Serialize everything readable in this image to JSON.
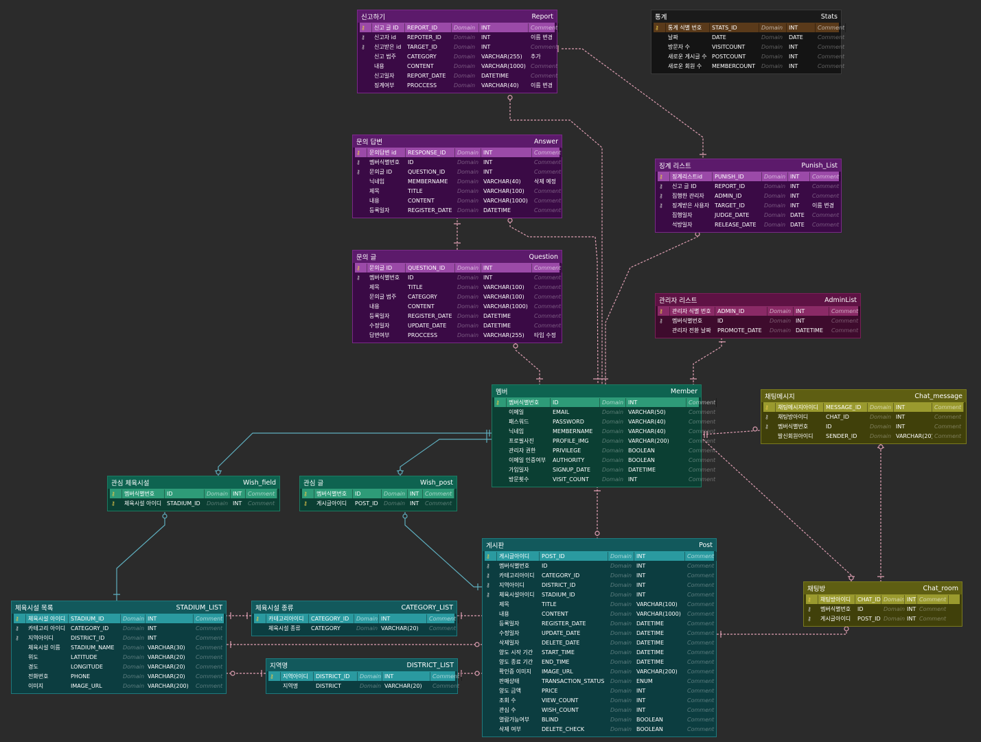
{
  "tables": [
    {
      "id": "report",
      "name": "신고하기",
      "code": "Report",
      "theme": "purple",
      "pos": [
        520,
        14,
        292
      ],
      "cols": [
        18,
        48,
        68,
        40,
        72,
        44
      ],
      "rows": [
        [
          "pk",
          "신고 글 ID",
          "REPORT_ID",
          "Domain",
          "INT",
          "Comment"
        ],
        [
          "fk",
          "신고자 id",
          "REPOTER_ID",
          "Domain",
          "INT",
          "이름 변경"
        ],
        [
          "fk",
          "신고받은 id",
          "TARGET_ID",
          "Domain",
          "INT",
          "Comment"
        ],
        [
          "",
          "신고 범주",
          "CATEGORY",
          "Domain",
          "VARCHAR(255)",
          "추가"
        ],
        [
          "",
          "내용",
          "CONTENT",
          "Domain",
          "VARCHAR(1000)",
          "Comment"
        ],
        [
          "",
          "신고일자",
          "REPORT_DATE",
          "Domain",
          "DATETIME",
          "Comment"
        ],
        [
          "",
          "징계여부",
          "PROCCESS",
          "Domain",
          "VARCHAR(40)",
          "이름 변경"
        ]
      ]
    },
    {
      "id": "stats",
      "name": "통계",
      "code": "Stats",
      "theme": "black",
      "pos": [
        948,
        14,
        278
      ],
      "cols": [
        18,
        64,
        72,
        40,
        42,
        44
      ],
      "rows": [
        [
          "pk",
          "통계 식별 번호",
          "STATS_ID",
          "Domain",
          "INT",
          "Comment"
        ],
        [
          "",
          "날짜",
          "DATE",
          "Domain",
          "DATE",
          "Comment"
        ],
        [
          "",
          "방문자 수",
          "VISITCOUNT",
          "Domain",
          "INT",
          "Comment"
        ],
        [
          "",
          "새로운 게시글 수",
          "POSTCOUNT",
          "Domain",
          "INT",
          "Comment"
        ],
        [
          "",
          "새로운 회원 수",
          "MEMBERCOUNT",
          "Domain",
          "INT",
          "Comment"
        ]
      ]
    },
    {
      "id": "answer",
      "name": "문의 답변",
      "code": "Answer",
      "theme": "purple",
      "pos": [
        513,
        196,
        306
      ],
      "cols": [
        18,
        56,
        72,
        38,
        74,
        44
      ],
      "rows": [
        [
          "pk",
          "문의답변 id",
          "RESPONSE_ID",
          "Domain",
          "INT",
          "Comment"
        ],
        [
          "fk",
          "멤버식별번호",
          "ID",
          "Domain",
          "INT",
          "Comment"
        ],
        [
          "fk",
          "문의글 ID",
          "QUESTION_ID",
          "Domain",
          "INT",
          "Comment"
        ],
        [
          "",
          "닉네임",
          "MEMBERNAME",
          "Domain",
          "VARCHAR(40)",
          "삭제 예정"
        ],
        [
          "",
          "제목",
          "TITLE",
          "Domain",
          "VARCHAR(100)",
          "Comment"
        ],
        [
          "",
          "내용",
          "CONTENT",
          "Domain",
          "VARCHAR(1000)",
          "Comment"
        ],
        [
          "",
          "등록일자",
          "REGISTER_DATE",
          "Domain",
          "DATETIME",
          "Comment"
        ]
      ]
    },
    {
      "id": "punish",
      "name": "징계 리스트",
      "code": "Punish_List",
      "theme": "purple",
      "pos": [
        954,
        231,
        272
      ],
      "cols": [
        18,
        62,
        72,
        38,
        32,
        44
      ],
      "rows": [
        [
          "pk",
          "징계리스트id",
          "PUNISH_ID",
          "Domain",
          "INT",
          "Comment"
        ],
        [
          "fk",
          "신고 글 ID",
          "REPORT_ID",
          "Domain",
          "INT",
          "Comment"
        ],
        [
          "fk",
          "집행한 관리자",
          "ADMIN_ID",
          "Domain",
          "INT",
          "Comment"
        ],
        [
          "fk",
          "징계받은 사용자",
          "TARGET_ID",
          "Domain",
          "INT",
          "이름 변경"
        ],
        [
          "",
          "집행일자",
          "JUDGE_DATE",
          "Domain",
          "DATE",
          "Comment"
        ],
        [
          "",
          "석방일자",
          "RELEASE_DATE",
          "Domain",
          "DATE",
          "Comment"
        ]
      ]
    },
    {
      "id": "question",
      "name": "문의 글",
      "code": "Question",
      "theme": "purple",
      "pos": [
        513,
        364,
        306
      ],
      "cols": [
        18,
        56,
        72,
        38,
        74,
        44
      ],
      "rows": [
        [
          "pk",
          "문의글 ID",
          "QUESTION_ID",
          "Domain",
          "INT",
          "Comment"
        ],
        [
          "fk",
          "멤버식별번호",
          "ID",
          "Domain",
          "INT",
          "Comment"
        ],
        [
          "",
          "제목",
          "TITLE",
          "Domain",
          "VARCHAR(100)",
          "Comment"
        ],
        [
          "",
          "문의글 범주",
          "CATEGORY",
          "Domain",
          "VARCHAR(100)",
          "Comment"
        ],
        [
          "",
          "내용",
          "CONTENT",
          "Domain",
          "VARCHAR(1000)",
          "Comment"
        ],
        [
          "",
          "등록일자",
          "REGISTER_DATE",
          "Domain",
          "DATETIME",
          "Comment"
        ],
        [
          "",
          "수정일자",
          "UPDATE_DATE",
          "Domain",
          "DATETIME",
          "Comment"
        ],
        [
          "",
          "답변여부",
          "PROCCESS",
          "Domain",
          "VARCHAR(255)",
          "타입 수정"
        ]
      ]
    },
    {
      "id": "admin",
      "name": "관리자 리스트",
      "code": "AdminList",
      "theme": "magenta",
      "pos": [
        954,
        427,
        300
      ],
      "cols": [
        18,
        66,
        76,
        38,
        52,
        44
      ],
      "rows": [
        [
          "pk",
          "관리자 식별 번호",
          "ADMIN_ID",
          "Domain",
          "INT",
          "Comment"
        ],
        [
          "fk",
          "멤버식별번호",
          "ID",
          "Domain",
          "INT",
          "Comment"
        ],
        [
          "",
          "관리자 전환 날짜",
          "PROMOTE_DATE",
          "Domain",
          "DATETIME",
          "Comment"
        ]
      ]
    },
    {
      "id": "member",
      "name": "멤버",
      "code": "Member",
      "theme": "green",
      "pos": [
        716,
        560,
        306
      ],
      "cols": [
        18,
        64,
        72,
        38,
        88,
        44
      ],
      "rows": [
        [
          "pk",
          "멤버식별번호",
          "ID",
          "Domain",
          "INT",
          "Comment"
        ],
        [
          "",
          "이메일",
          "EMAIL",
          "Domain",
          "VARCHAR(50)",
          "Comment"
        ],
        [
          "",
          "패스워드",
          "PASSWORD",
          "Domain",
          "VARCHAR(40)",
          "Comment"
        ],
        [
          "",
          "닉네임",
          "MEMBERNAME",
          "Domain",
          "VARCHAR(40)",
          "Comment"
        ],
        [
          "",
          "프로필사진",
          "PROFILE_IMG",
          "Domain",
          "VARCHAR(200)",
          "Comment"
        ],
        [
          "",
          "관리자 권한",
          "PRIVILEGE",
          "Domain",
          "BOOLEAN",
          "Comment"
        ],
        [
          "",
          "이메일 인증여부",
          "AUTHORITY",
          "Domain",
          "BOOLEAN",
          "Comment"
        ],
        [
          "",
          "가입일자",
          "SIGNUP_DATE",
          "Domain",
          "DATETIME",
          "Comment"
        ],
        [
          "",
          "방문횟수",
          "VISIT_COUNT",
          "Domain",
          "INT",
          "Comment"
        ]
      ]
    },
    {
      "id": "chatmsg",
      "name": "채팅메시지",
      "code": "Chat_message",
      "theme": "olive",
      "pos": [
        1108,
        567,
        300
      ],
      "cols": [
        18,
        70,
        64,
        38,
        56,
        46
      ],
      "rows": [
        [
          "pk",
          "채팅메시지아이디",
          "MESSAGE_ID",
          "Domain",
          "INT",
          "Comment"
        ],
        [
          "fk",
          "채팅방아이디",
          "CHAT_ID",
          "Domain",
          "INT",
          "Comment"
        ],
        [
          "fk",
          "멤버식별번호",
          "ID",
          "Domain",
          "INT",
          "Comment"
        ],
        [
          "",
          "발신회원아이디",
          "SENDER_ID",
          "Domain",
          "VARCHAR(20)",
          "Comment"
        ]
      ]
    },
    {
      "id": "wishfield",
      "name": "관심 체육시설",
      "code": "Wish_field",
      "theme": "green",
      "pos": [
        156,
        693,
        252
      ],
      "cols": [
        18,
        62,
        58,
        38,
        22,
        46
      ],
      "rows": [
        [
          "pk",
          "멤버식별번호",
          "ID",
          "Domain",
          "INT",
          "Comment"
        ],
        [
          "pk",
          "체육시설 아이디",
          "STADIUM_ID",
          "Domain",
          "INT",
          "Comment"
        ]
      ]
    },
    {
      "id": "wishpost",
      "name": "관심 글",
      "code": "Wish_post",
      "theme": "green",
      "pos": [
        436,
        693,
        230
      ],
      "cols": [
        18,
        56,
        42,
        38,
        22,
        46
      ],
      "rows": [
        [
          "pk",
          "멤버식별번호",
          "ID",
          "Domain",
          "INT",
          "Comment"
        ],
        [
          "pk",
          "게시글아이디",
          "POST_ID",
          "Domain",
          "INT",
          "Comment"
        ]
      ]
    },
    {
      "id": "post",
      "name": "게시판",
      "code": "Post",
      "theme": "teal",
      "pos": [
        702,
        784,
        342
      ],
      "cols": [
        18,
        62,
        100,
        38,
        74,
        46
      ],
      "rows": [
        [
          "pk",
          "게시글아이디",
          "POST_ID",
          "Domain",
          "INT",
          "Comment"
        ],
        [
          "fk",
          "멤버식별번호",
          "ID",
          "Domain",
          "INT",
          "Comment"
        ],
        [
          "fk",
          "카테고리아이디",
          "CATEGORY_ID",
          "Domain",
          "INT",
          "Comment"
        ],
        [
          "fk",
          "지역아이디",
          "DISTRICT_ID",
          "Domain",
          "INT",
          "Comment"
        ],
        [
          "fk",
          "체육시설아이디",
          "STADIUM_ID",
          "Domain",
          "INT",
          "Comment"
        ],
        [
          "",
          "제목",
          "TITLE",
          "Domain",
          "VARCHAR(100)",
          "Comment"
        ],
        [
          "",
          "내용",
          "CONTENT",
          "Domain",
          "VARCHAR(1000)",
          "Comment"
        ],
        [
          "",
          "등록일자",
          "REGISTER_DATE",
          "Domain",
          "DATETIME",
          "Comment"
        ],
        [
          "",
          "수정일자",
          "UPDATE_DATE",
          "Domain",
          "DATETIME",
          "Comment"
        ],
        [
          "",
          "삭제일자",
          "DELETE_DATE",
          "Domain",
          "DATETIME",
          "Comment"
        ],
        [
          "",
          "양도 시작 기간",
          "START_TIME",
          "Domain",
          "DATETIME",
          "Comment"
        ],
        [
          "",
          "양도 종료 기간",
          "END_TIME",
          "Domain",
          "DATETIME",
          "Comment"
        ],
        [
          "",
          "확인증 이미지",
          "IMAGE_URL",
          "Domain",
          "VARCHAR(200)",
          "Comment"
        ],
        [
          "",
          "판매상태",
          "TRANSACTION_STATUS",
          "Domain",
          "ENUM",
          "Comment"
        ],
        [
          "",
          "양도 금액",
          "PRICE",
          "Domain",
          "INT",
          "Comment"
        ],
        [
          "",
          "조회 수",
          "VIEW_COUNT",
          "Domain",
          "INT",
          "Comment"
        ],
        [
          "",
          "관심 수",
          "WISH_COUNT",
          "Domain",
          "INT",
          "Comment"
        ],
        [
          "",
          "열람가능여부",
          "BLIND",
          "Domain",
          "BOOLEAN",
          "Comment"
        ],
        [
          "",
          "삭제 여부",
          "DELETE_CHECK",
          "Domain",
          "BOOLEAN",
          "Comment"
        ]
      ]
    },
    {
      "id": "chatroom",
      "name": "채팅방",
      "code": "Chat_room",
      "theme": "olive",
      "pos": [
        1170,
        847,
        232
      ],
      "cols": [
        18,
        54,
        38,
        34,
        18,
        46
      ],
      "rows": [
        [
          "pk",
          "채팅방아이디",
          "CHAT_ID",
          "Domain",
          "INT",
          "Comment"
        ],
        [
          "fk",
          "멤버식별번호",
          "ID",
          "Domain",
          "INT",
          "Comment"
        ],
        [
          "fk",
          "게시글아이디",
          "POST_ID",
          "Domain",
          "INT",
          "Comment"
        ]
      ]
    },
    {
      "id": "stadium",
      "name": "체육시설 목록",
      "code": "STADIUM_LIST",
      "theme": "teal",
      "pos": [
        16,
        875,
        314
      ],
      "cols": [
        18,
        62,
        76,
        36,
        70,
        46
      ],
      "rows": [
        [
          "pk",
          "체육시설 아이디",
          "STADIUM_ID",
          "Domain",
          "INT",
          "Comment"
        ],
        [
          "fk",
          "카테고리 아이디",
          "CATEGORY_ID",
          "Domain",
          "INT",
          "Comment"
        ],
        [
          "fk",
          "지역아이디",
          "DISTRICT_ID",
          "Domain",
          "INT",
          "Comment"
        ],
        [
          "",
          "체육시설 이름",
          "STADIUM_NAME",
          "Domain",
          "VARCHAR(30)",
          "Comment"
        ],
        [
          "",
          "위도",
          "LATITUDE",
          "Domain",
          "VARCHAR(20)",
          "Comment"
        ],
        [
          "",
          "경도",
          "LONGITUDE",
          "Domain",
          "VARCHAR(20)",
          "Comment"
        ],
        [
          "",
          "전화번호",
          "PHONE",
          "Domain",
          "VARCHAR(20)",
          "Comment"
        ],
        [
          "",
          "이미지",
          "IMAGE_URL",
          "Domain",
          "VARCHAR(200)",
          "Comment"
        ]
      ]
    },
    {
      "id": "category",
      "name": "체육시설 종류",
      "code": "CATEGORY_LIST",
      "theme": "teal",
      "pos": [
        366,
        875,
        300
      ],
      "cols": [
        18,
        62,
        66,
        36,
        70,
        46
      ],
      "rows": [
        [
          "pk",
          "카테고리아이디",
          "CATEGORY_ID",
          "Domain",
          "INT",
          "Comment"
        ],
        [
          "",
          "체육시설 종류",
          "CATEGORY",
          "Domain",
          "VARCHAR(20)",
          "Comment"
        ]
      ]
    },
    {
      "id": "district",
      "name": "지역명",
      "code": "DISTRICT_LIST",
      "theme": "teal",
      "pos": [
        387,
        959,
        280
      ],
      "cols": [
        18,
        48,
        64,
        36,
        70,
        46
      ],
      "rows": [
        [
          "pk",
          "지역아이디",
          "DISTRICT_ID",
          "Domain",
          "INT",
          "Comment"
        ],
        [
          "",
          "지역명",
          "DISTRICT",
          "Domain",
          "VARCHAR(20)",
          "Comment"
        ]
      ]
    }
  ],
  "icons": {
    "pk": "key-icon",
    "fk": "foreign-key-icon"
  },
  "colors": {
    "background": "#2b2b2b",
    "relation_pink": "#e0a0b4",
    "relation_teal": "#5fb0c0"
  }
}
